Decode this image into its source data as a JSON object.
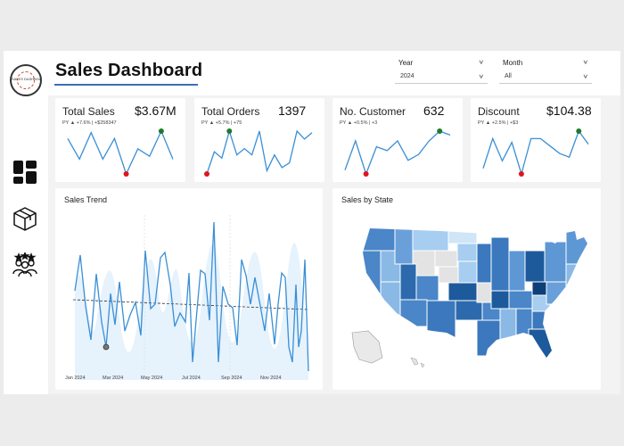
{
  "header": {
    "title": "Sales Dashboard",
    "filters": [
      {
        "label": "Year",
        "value": "2024"
      },
      {
        "label": "Month",
        "value": "All"
      }
    ]
  },
  "sidebar": {
    "logo_text": "SALES DASHBOARD",
    "items": [
      {
        "icon": "dashboard-grid-icon"
      },
      {
        "icon": "package-box-icon"
      },
      {
        "icon": "customers-group-icon"
      }
    ]
  },
  "kpis": [
    {
      "title": "Total Sales",
      "value": "$3.67M",
      "sub": "PY ▲ +7.6% | +$258347",
      "spark": [
        52,
        38,
        56,
        38,
        52,
        28,
        45,
        40,
        57,
        38
      ]
    },
    {
      "title": "Total Orders",
      "value": "1397",
      "sub": "PY ▲ +5.7% | +75",
      "spark": [
        28,
        42,
        38,
        55,
        40,
        44,
        40,
        55,
        30,
        40,
        32,
        35,
        55,
        50,
        54
      ]
    },
    {
      "title": "No. Customer",
      "value": "632",
      "sub": "PY ▲ +0.5% | +3",
      "spark": [
        40,
        55,
        38,
        52,
        50,
        55,
        45,
        48,
        55,
        60,
        58
      ]
    },
    {
      "title": "Discount",
      "value": "$104.38",
      "sub": "PY ▲ +2.5% | +$3",
      "spark": [
        40,
        56,
        44,
        54,
        37,
        56,
        56,
        52,
        48,
        46,
        60,
        53
      ]
    }
  ],
  "sales_trend": {
    "title": "Sales Trend",
    "x_ticks": [
      "Jan 2024",
      "Mar 2024",
      "May 2024",
      "Jul 2024",
      "Sep 2024",
      "Nov 2024"
    ]
  },
  "map": {
    "title": "Sales by State"
  },
  "colors": {
    "accent": "#3b6fb6",
    "line": "#3a8fd6",
    "band": "#e3f0fb",
    "max_marker": "#1f7a2e",
    "min_marker": "#e0141e"
  }
}
